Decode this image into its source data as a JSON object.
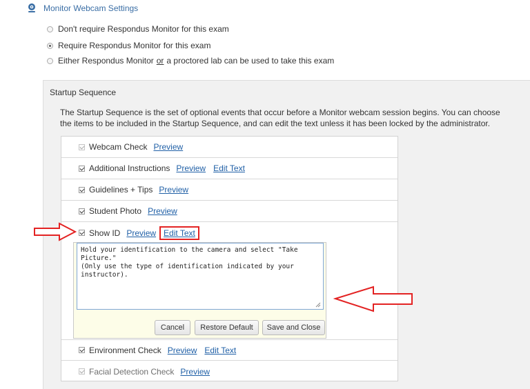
{
  "section": {
    "title": "Monitor Webcam Settings",
    "icon": "webcam-icon",
    "accent_color": "#3a6ea5"
  },
  "radio_options": [
    {
      "parts": [
        "Don't require Respondus Monitor for this exam"
      ],
      "checked": false
    },
    {
      "parts": [
        "Require Respondus Monitor for this exam"
      ],
      "checked": true
    },
    {
      "parts": [
        "Either Respondus Monitor",
        "or",
        "a proctored lab can be used to take this exam"
      ],
      "checked": false
    }
  ],
  "startup": {
    "title": "Startup Sequence",
    "description": "The Startup Sequence is the set of optional events that occur before a Monitor webcam session begins. You can choose the items to be included in the Startup Sequence, and can edit the text unless it has been locked by the administrator.",
    "items": [
      {
        "label": "Webcam Check",
        "checked": true,
        "locked": true,
        "preview": "Preview"
      },
      {
        "label": "Additional Instructions",
        "checked": true,
        "locked": false,
        "preview": "Preview",
        "edit": "Edit Text"
      },
      {
        "label": "Guidelines + Tips",
        "checked": true,
        "locked": false,
        "preview": "Preview"
      },
      {
        "label": "Student Photo",
        "checked": true,
        "locked": false,
        "preview": "Preview"
      },
      {
        "label": "Show ID",
        "checked": true,
        "locked": false,
        "preview": "Preview",
        "edit": "Edit Text"
      },
      {
        "label": "Environment Check",
        "checked": true,
        "locked": false,
        "preview": "Preview",
        "edit": "Edit Text"
      },
      {
        "label": "Facial Detection Check",
        "checked": true,
        "locked": true,
        "preview": "Preview"
      }
    ],
    "editor": {
      "text": "Hold your identification to the camera and select \"Take Picture.\"\n(Only use the type of identification indicated by your instructor).",
      "cancel_label": "Cancel",
      "restore_label": "Restore Default",
      "save_label": "Save and Close"
    }
  },
  "annotations": {
    "highlight_color": "#e32222",
    "arrow_1_target": "Show ID",
    "arrow_2_target": "editor-textarea"
  }
}
